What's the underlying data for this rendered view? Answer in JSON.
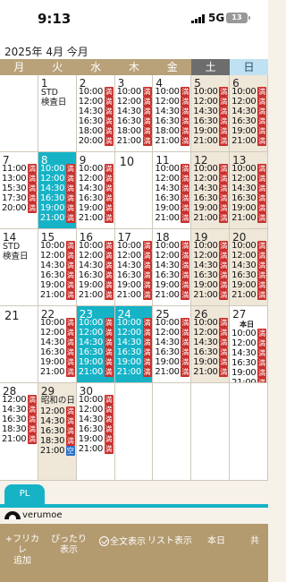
{
  "status_bar": {
    "time": "9:13",
    "network": "5G",
    "battery": "13"
  },
  "header": {
    "title": "2025年 4月 今月"
  },
  "weekdays": [
    "月",
    "火",
    "水",
    "木",
    "金",
    "土",
    "日"
  ],
  "badges": {
    "full": "満",
    "open": "空"
  },
  "colors": {
    "accent": "#16b3c7",
    "full_badge": "#c9302c",
    "open_badge": "#2a6fc9",
    "toolbar": "#b39a6f",
    "weekday_header": "#b9a179"
  },
  "calendar": {
    "weeks": [
      [
        {
          "day": "",
          "type": "empty"
        },
        {
          "day": "1",
          "type": "normal",
          "note": "STD\n検査日",
          "slots": []
        },
        {
          "day": "2",
          "type": "normal",
          "slots": [
            {
              "time": "10:00",
              "status": "full"
            },
            {
              "time": "12:00",
              "status": "full"
            },
            {
              "time": "14:30",
              "status": "full"
            },
            {
              "time": "16:30",
              "status": "full"
            },
            {
              "time": "18:00",
              "status": "full"
            },
            {
              "time": "20:00",
              "status": "full"
            }
          ]
        },
        {
          "day": "3",
          "type": "normal",
          "slots": [
            {
              "time": "10:00",
              "status": "full"
            },
            {
              "time": "12:00",
              "status": "full"
            },
            {
              "time": "14:30",
              "status": "full"
            },
            {
              "time": "16:30",
              "status": "full"
            },
            {
              "time": "18:00",
              "status": "full"
            },
            {
              "time": "21:00",
              "status": "full"
            }
          ]
        },
        {
          "day": "4",
          "type": "normal",
          "slots": [
            {
              "time": "10:00",
              "status": "full"
            },
            {
              "time": "12:00",
              "status": "full"
            },
            {
              "time": "14:30",
              "status": "full"
            },
            {
              "time": "16:30",
              "status": "full"
            },
            {
              "time": "18:00",
              "status": "full"
            },
            {
              "time": "21:00",
              "status": "full"
            }
          ]
        },
        {
          "day": "5",
          "type": "weekend",
          "slots": [
            {
              "time": "10:00",
              "status": "full"
            },
            {
              "time": "12:00",
              "status": "full"
            },
            {
              "time": "14:30",
              "status": "full"
            },
            {
              "time": "16:30",
              "status": "full"
            },
            {
              "time": "19:00",
              "status": "full"
            },
            {
              "time": "21:00",
              "status": "full"
            }
          ]
        },
        {
          "day": "6",
          "type": "weekend",
          "slots": [
            {
              "time": "10:00",
              "status": "full"
            },
            {
              "time": "12:00",
              "status": "full"
            },
            {
              "time": "14:30",
              "status": "full"
            },
            {
              "time": "16:30",
              "status": "full"
            },
            {
              "time": "19:00",
              "status": "full"
            },
            {
              "time": "21:00",
              "status": "full"
            }
          ]
        }
      ],
      [
        {
          "day": "7",
          "type": "normal",
          "slots": [
            {
              "time": "11:00",
              "status": "full"
            },
            {
              "time": "13:00",
              "status": "full"
            },
            {
              "time": "15:30",
              "status": "full"
            },
            {
              "time": "17:30",
              "status": "full"
            },
            {
              "time": "20:00",
              "status": "full"
            }
          ]
        },
        {
          "day": "8",
          "type": "selected",
          "slots": [
            {
              "time": "10:00",
              "status": "full"
            },
            {
              "time": "12:00",
              "status": "full"
            },
            {
              "time": "14:30",
              "status": "full"
            },
            {
              "time": "16:30",
              "status": "full"
            },
            {
              "time": "19:00",
              "status": "full"
            },
            {
              "time": "21:00",
              "status": "full"
            }
          ]
        },
        {
          "day": "9",
          "type": "normal",
          "slots": [
            {
              "time": "10:00",
              "status": "full"
            },
            {
              "time": "12:00",
              "status": "full"
            },
            {
              "time": "14:30",
              "status": "full"
            },
            {
              "time": "16:30",
              "status": "full"
            },
            {
              "time": "19:00",
              "status": "full"
            },
            {
              "time": "21:00",
              "status": "full"
            }
          ]
        },
        {
          "day": "10",
          "type": "normal",
          "big": true,
          "slots": []
        },
        {
          "day": "11",
          "type": "normal",
          "slots": [
            {
              "time": "10:00",
              "status": "full"
            },
            {
              "time": "12:00",
              "status": "full"
            },
            {
              "time": "14:30",
              "status": "full"
            },
            {
              "time": "16:30",
              "status": "full"
            },
            {
              "time": "19:00",
              "status": "full"
            },
            {
              "time": "21:00",
              "status": "full"
            }
          ]
        },
        {
          "day": "12",
          "type": "weekend",
          "slots": [
            {
              "time": "10:00",
              "status": "full"
            },
            {
              "time": "12:00",
              "status": "full"
            },
            {
              "time": "14:30",
              "status": "full"
            },
            {
              "time": "16:30",
              "status": "full"
            },
            {
              "time": "19:00",
              "status": "full"
            },
            {
              "time": "21:00",
              "status": "full"
            }
          ]
        },
        {
          "day": "13",
          "type": "weekend",
          "slots": [
            {
              "time": "10:00",
              "status": "full"
            },
            {
              "time": "12:00",
              "status": "full"
            },
            {
              "time": "14:30",
              "status": "full"
            },
            {
              "time": "16:30",
              "status": "full"
            },
            {
              "time": "19:00",
              "status": "full"
            },
            {
              "time": "21:00",
              "status": "full"
            }
          ]
        }
      ],
      [
        {
          "day": "14",
          "type": "normal",
          "note": "STD\n検査日",
          "slots": []
        },
        {
          "day": "15",
          "type": "normal",
          "slots": [
            {
              "time": "10:00",
              "status": "full"
            },
            {
              "time": "12:00",
              "status": "full"
            },
            {
              "time": "14:30",
              "status": "full"
            },
            {
              "time": "16:30",
              "status": "full"
            },
            {
              "time": "19:00",
              "status": "full"
            },
            {
              "time": "21:00",
              "status": "full"
            }
          ]
        },
        {
          "day": "16",
          "type": "normal",
          "slots": [
            {
              "time": "10:00",
              "status": "full"
            },
            {
              "time": "12:00",
              "status": "full"
            },
            {
              "time": "14:30",
              "status": "full"
            },
            {
              "time": "16:30",
              "status": "full"
            },
            {
              "time": "19:00",
              "status": "full"
            },
            {
              "time": "21:00",
              "status": "full"
            }
          ]
        },
        {
          "day": "17",
          "type": "normal",
          "slots": [
            {
              "time": "10:00",
              "status": "full"
            },
            {
              "time": "12:00",
              "status": "full"
            },
            {
              "time": "14:30",
              "status": "full"
            },
            {
              "time": "16:30",
              "status": "full"
            },
            {
              "time": "19:00",
              "status": "full"
            },
            {
              "time": "21:00",
              "status": "full"
            }
          ]
        },
        {
          "day": "18",
          "type": "normal",
          "slots": [
            {
              "time": "10:00",
              "status": "full"
            },
            {
              "time": "12:00",
              "status": "full"
            },
            {
              "time": "14:30",
              "status": "full"
            },
            {
              "time": "16:30",
              "status": "full"
            },
            {
              "time": "19:00",
              "status": "full"
            },
            {
              "time": "21:00",
              "status": "full"
            }
          ]
        },
        {
          "day": "19",
          "type": "weekend",
          "slots": [
            {
              "time": "10:00",
              "status": "full"
            },
            {
              "time": "12:00",
              "status": "full"
            },
            {
              "time": "14:30",
              "status": "full"
            },
            {
              "time": "16:30",
              "status": "full"
            },
            {
              "time": "19:00",
              "status": "full"
            },
            {
              "time": "21:00",
              "status": "full"
            }
          ]
        },
        {
          "day": "20",
          "type": "weekend",
          "slots": [
            {
              "time": "10:00",
              "status": "full"
            },
            {
              "time": "12:00",
              "status": "full"
            },
            {
              "time": "14:30",
              "status": "full"
            },
            {
              "time": "16:30",
              "status": "full"
            },
            {
              "time": "19:00",
              "status": "full"
            },
            {
              "time": "21:00",
              "status": "full"
            }
          ]
        }
      ],
      [
        {
          "day": "21",
          "type": "normal",
          "big": true,
          "slots": []
        },
        {
          "day": "22",
          "type": "normal",
          "slots": [
            {
              "time": "10:00",
              "status": "full"
            },
            {
              "time": "12:00",
              "status": "full"
            },
            {
              "time": "14:30",
              "status": "full"
            },
            {
              "time": "16:30",
              "status": "full"
            },
            {
              "time": "19:00",
              "status": "full"
            },
            {
              "time": "21:00",
              "status": "full"
            }
          ]
        },
        {
          "day": "23",
          "type": "selected",
          "slots": [
            {
              "time": "10:00",
              "status": "full"
            },
            {
              "time": "12:00",
              "status": "full"
            },
            {
              "time": "14:30",
              "status": "full"
            },
            {
              "time": "16:30",
              "status": "full"
            },
            {
              "time": "19:00",
              "status": "full"
            },
            {
              "time": "21:00",
              "status": "full"
            }
          ]
        },
        {
          "day": "24",
          "type": "selected",
          "slots": [
            {
              "time": "10:00",
              "status": "full"
            },
            {
              "time": "12:00",
              "status": "full"
            },
            {
              "time": "14:30",
              "status": "full"
            },
            {
              "time": "16:30",
              "status": "full"
            },
            {
              "time": "19:00",
              "status": "full"
            },
            {
              "time": "21:00",
              "status": "full"
            }
          ]
        },
        {
          "day": "25",
          "type": "normal",
          "slots": [
            {
              "time": "10:00",
              "status": "full"
            },
            {
              "time": "12:00",
              "status": "full"
            },
            {
              "time": "14:30",
              "status": "full"
            },
            {
              "time": "16:30",
              "status": "full"
            },
            {
              "time": "19:00",
              "status": "full"
            },
            {
              "time": "21:00",
              "status": "full"
            }
          ]
        },
        {
          "day": "26",
          "type": "weekend",
          "slots": [
            {
              "time": "10:00",
              "status": "full"
            },
            {
              "time": "12:00",
              "status": "full"
            },
            {
              "time": "14:30",
              "status": "full"
            },
            {
              "time": "16:30",
              "status": "full"
            },
            {
              "time": "19:00",
              "status": "full"
            },
            {
              "time": "21:00",
              "status": "full"
            }
          ]
        },
        {
          "day": "27",
          "type": "normal",
          "today": true,
          "today_label": "本日",
          "slots": [
            {
              "time": "10:00",
              "status": "full"
            },
            {
              "time": "12:00",
              "status": "full"
            },
            {
              "time": "14:30",
              "status": "full"
            },
            {
              "time": "16:30",
              "status": "full"
            },
            {
              "time": "19:00",
              "status": "full"
            },
            {
              "time": "21:00",
              "status": "full"
            }
          ]
        }
      ],
      [
        {
          "day": "28",
          "type": "normal",
          "slots": [
            {
              "time": "12:00",
              "status": "full"
            },
            {
              "time": "14:30",
              "status": "full"
            },
            {
              "time": "16:30",
              "status": "full"
            },
            {
              "time": "18:30",
              "status": "full"
            },
            {
              "time": "21:00",
              "status": "full"
            }
          ]
        },
        {
          "day": "29",
          "type": "weekend",
          "note": "昭和の日",
          "slots": [
            {
              "time": "12:00",
              "status": "full"
            },
            {
              "time": "14:30",
              "status": "full"
            },
            {
              "time": "16:30",
              "status": "full"
            },
            {
              "time": "18:30",
              "status": "full"
            },
            {
              "time": "21:00",
              "status": "open"
            }
          ]
        },
        {
          "day": "30",
          "type": "normal",
          "slots": [
            {
              "time": "10:00",
              "status": "full"
            },
            {
              "time": "12:00",
              "status": "full"
            },
            {
              "time": "14:30",
              "status": "full"
            },
            {
              "time": "16:30",
              "status": "full"
            },
            {
              "time": "19:00",
              "status": "full"
            },
            {
              "time": "21:00",
              "status": "full"
            }
          ]
        },
        {
          "day": "",
          "type": "empty"
        },
        {
          "day": "",
          "type": "empty"
        },
        {
          "day": "",
          "type": "empty"
        },
        {
          "day": "",
          "type": "empty"
        }
      ]
    ]
  },
  "bottom": {
    "pl_button": "PL",
    "brand": "verumoe"
  },
  "toolbar": {
    "items": [
      {
        "label": "+フリカレ\n追加",
        "name": "add-furikare-button"
      },
      {
        "label": "ぴったり\n表示",
        "name": "fit-view-button"
      },
      {
        "label": "全文表示",
        "name": "full-text-button",
        "icon": "check-circle-icon"
      },
      {
        "label": "リスト表示",
        "name": "list-view-button"
      },
      {
        "label": "本日",
        "name": "today-button"
      },
      {
        "label": "共",
        "name": "share-button"
      }
    ]
  }
}
